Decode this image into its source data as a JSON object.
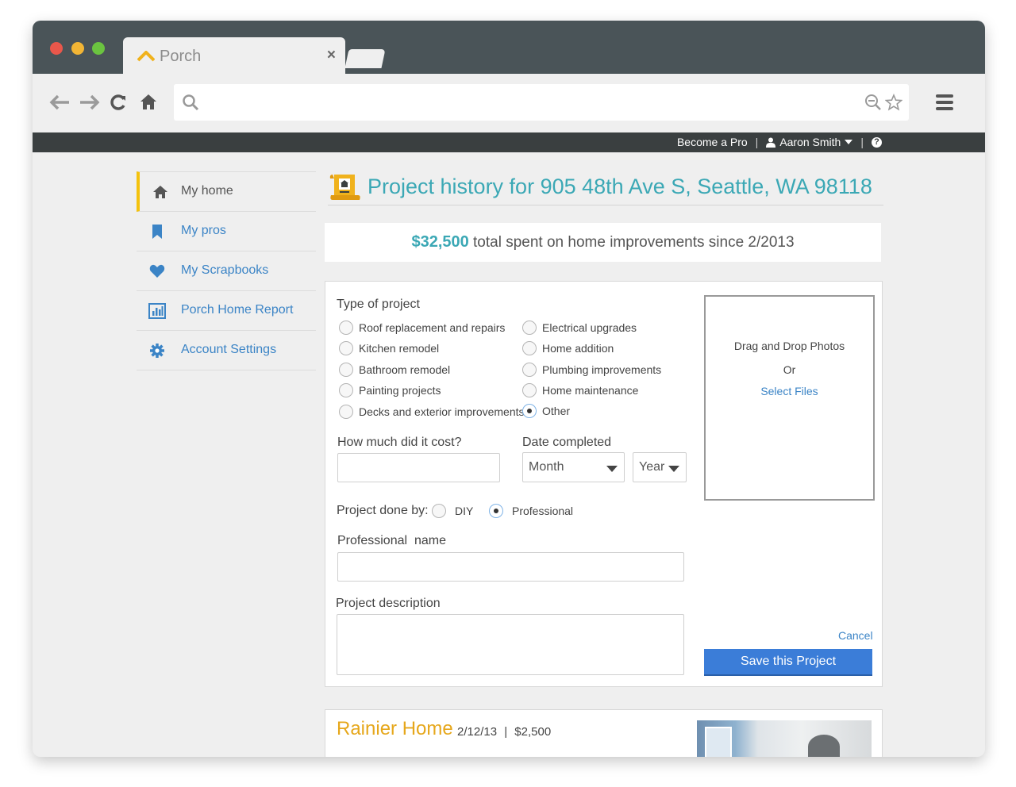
{
  "browser": {
    "tab_title": "Porch",
    "tab_close": "×"
  },
  "topbar": {
    "become_pro": "Become a Pro",
    "separator": "|",
    "user_name": "Aaron Smith",
    "help": "?"
  },
  "sidebar": {
    "items": [
      {
        "label": "My home",
        "icon": "home-icon"
      },
      {
        "label": "My pros",
        "icon": "bookmark-icon"
      },
      {
        "label": "My Scrapbooks",
        "icon": "heart-icon"
      },
      {
        "label": "Porch Home Report",
        "icon": "bar-chart-icon"
      },
      {
        "label": "Account Settings",
        "icon": "gear-icon"
      }
    ]
  },
  "page": {
    "title": "Project history for 905 48th Ave S, Seattle, WA 98118",
    "summary_amount": "$32,500",
    "summary_text": "total spent on home improvements since 2/2013"
  },
  "form": {
    "type_label": "Type of project",
    "project_types_left": [
      "Roof replacement and repairs",
      "Kitchen remodel",
      "Bathroom remodel",
      "Painting projects",
      "Decks and exterior improvements"
    ],
    "project_types_right": [
      "Electrical upgrades",
      "Home addition",
      "Plumbing improvements",
      "Home maintenance",
      "Other"
    ],
    "selected_type": "Other",
    "cost_label": "How much did it cost?",
    "cost_value": "",
    "date_label": "Date completed",
    "month_value": "Month",
    "year_value": "Year",
    "done_by_label": "Project done by:",
    "done_by_options": [
      "DIY",
      "Professional"
    ],
    "done_by_selected": "Professional",
    "pro_name_label": "Professional  name",
    "pro_name_value": "",
    "description_label": "Project description",
    "description_value": "",
    "dropzone_line1": "Drag and Drop Photos",
    "dropzone_or": "Or",
    "dropzone_link": "Select Files",
    "cancel_label": "Cancel",
    "save_label": "Save this Project"
  },
  "history": [
    {
      "pro": "Rainier Home",
      "date": "2/12/13",
      "separator": "|",
      "cost": "$2,500"
    }
  ],
  "colors": {
    "accent_teal": "#3ba8b5",
    "link_blue": "#3b84c6",
    "button_blue": "#3b7dd8",
    "active_yellow": "#f4c20d",
    "card_title_orange": "#e6a71b"
  }
}
